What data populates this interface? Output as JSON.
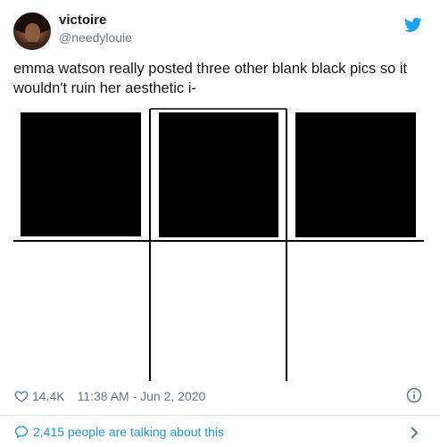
{
  "user": {
    "name": "victoire",
    "handle": "@needylouie"
  },
  "tweet": {
    "text": "emma watson really posted three other blank black pics so it wouldn't ruin her aesthetic i-"
  },
  "meta": {
    "likes": "14.4K",
    "timestamp": "11:38 AM - Jun 2, 2020"
  },
  "footer": {
    "talking": "2,415 people are talking about this"
  },
  "icons": {
    "brand": "twitter-bird-icon",
    "like": "heart-icon",
    "info": "info-icon",
    "talk": "speech-bubble-icon",
    "more": "chevron-right-icon"
  },
  "colors": {
    "twitter_blue": "#1da1f2",
    "link_blue": "#1b95e0",
    "secondary_text": "#657786",
    "primary_text": "#14171a"
  }
}
